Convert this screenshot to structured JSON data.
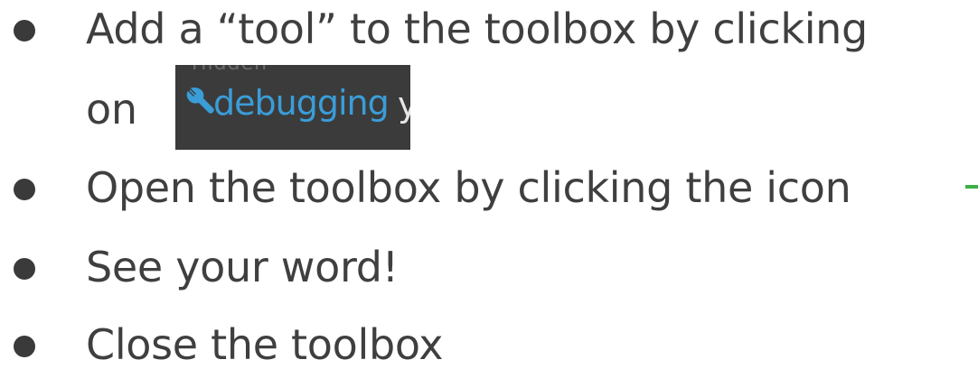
{
  "slide": {
    "bullets": [
      {
        "text": "Add a “tool” to the toolbox by clicking"
      },
      {
        "text": "on"
      },
      {
        "text": "Open the toolbox by clicking the icon"
      },
      {
        "text": "See your word!"
      },
      {
        "text": "Close the toolbox"
      }
    ],
    "inline_image": {
      "label": "debugging",
      "trailing": "y",
      "icon": "wrench-icon",
      "label_color": "#3a9dd8",
      "background": "#3b3b3b"
    },
    "accent_color": "#3cb043",
    "text_color": "#3f3f3f"
  }
}
